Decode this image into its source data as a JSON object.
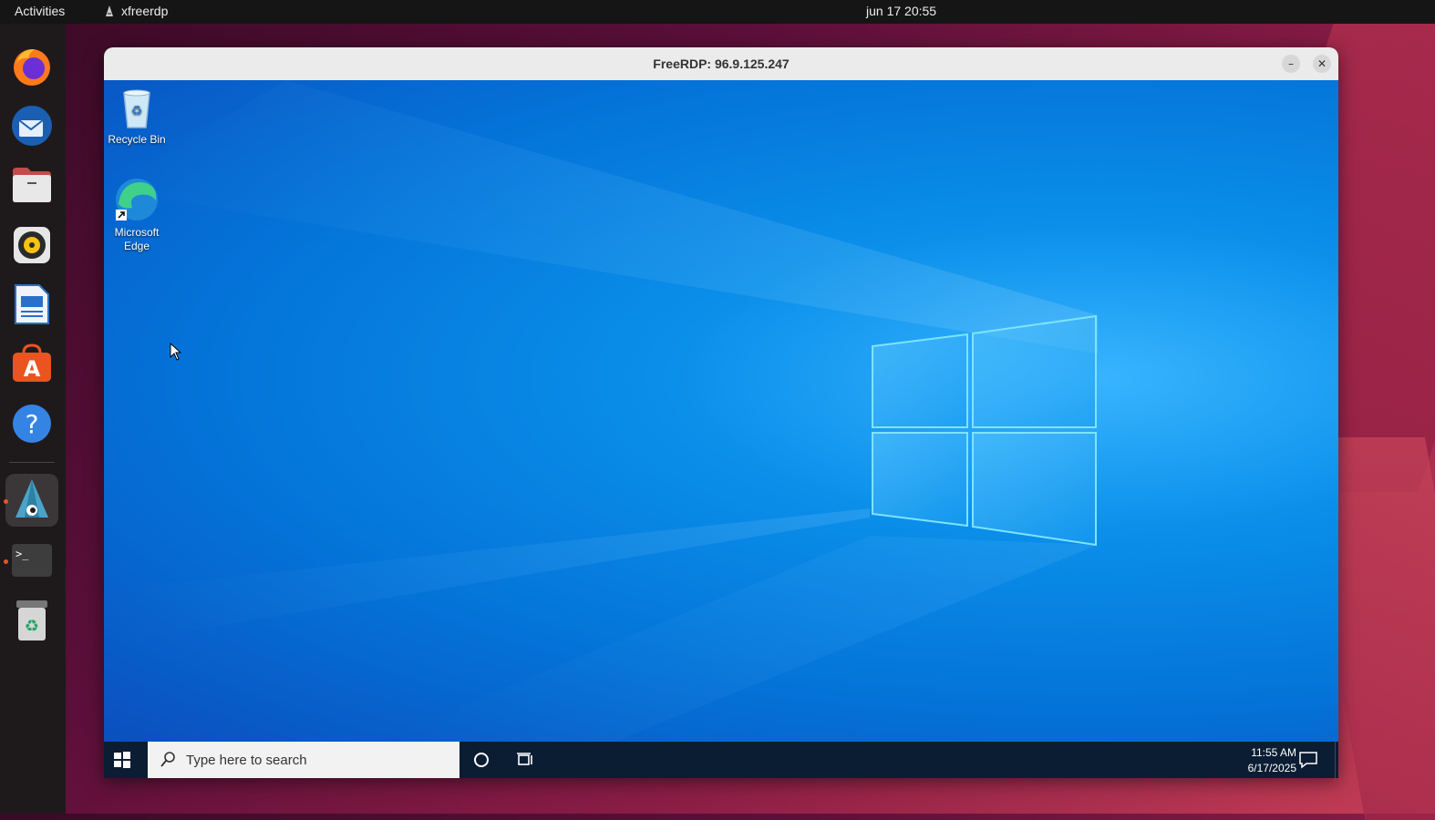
{
  "topbar": {
    "activities": "Activities",
    "app_name": "xfreerdp",
    "datetime": "jun 17  20:55"
  },
  "dock": {
    "items": [
      {
        "name": "firefox-icon"
      },
      {
        "name": "thunderbird-icon"
      },
      {
        "name": "files-icon"
      },
      {
        "name": "rhythmbox-icon"
      },
      {
        "name": "libreoffice-writer-icon"
      },
      {
        "name": "app-center-icon"
      },
      {
        "name": "help-icon"
      },
      {
        "name": "remmina-icon",
        "active": true,
        "running": true
      },
      {
        "name": "terminal-icon",
        "running": true
      },
      {
        "name": "trash-icon"
      }
    ]
  },
  "window": {
    "title": "FreeRDP: 96.9.125.247",
    "minimize_symbol": "–",
    "close_symbol": "✕"
  },
  "desktop": {
    "icons": [
      {
        "label": "Recycle Bin"
      },
      {
        "label": "Microsoft Edge"
      }
    ]
  },
  "taskbar": {
    "search_placeholder": "Type here to search",
    "time": "11:55 AM",
    "date": "6/17/2025"
  },
  "colors": {
    "ubuntu_accent": "#e95420",
    "windows_blue": "#0a8fea",
    "taskbar": "#0b1d33"
  }
}
